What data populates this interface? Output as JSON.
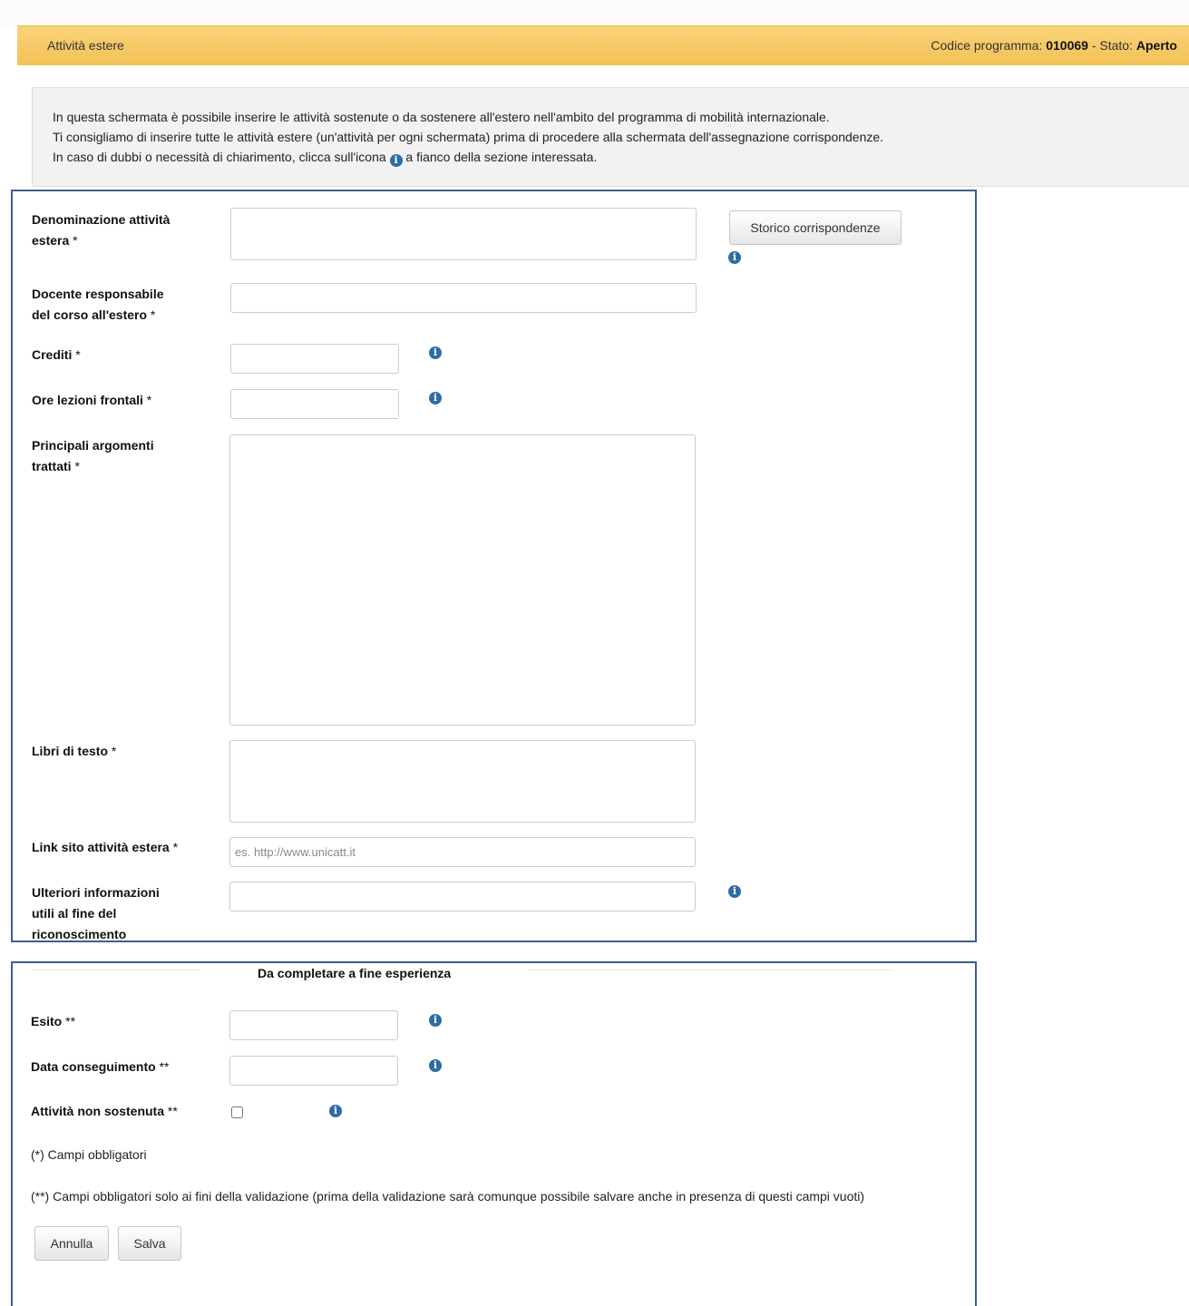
{
  "header": {
    "title": "Attività estere",
    "program_label": "Codice programma: ",
    "program_code": "010069",
    "status_sep": " - Stato: ",
    "status_value": "Aperto"
  },
  "info": {
    "line1": "In questa schermata è possibile inserire le attività sostenute o da sostenere all'estero nell'ambito del programma di mobilità internazionale.",
    "line2": "Ti consigliamo di inserire tutte le attività estere (un'attività per ogni schermata) prima di procedere alla schermata dell'assegnazione corrispondenze.",
    "line3_before": "In caso di dubbi o necessità di chiarimento, clicca sull'icona ",
    "line3_after": " a fianco della sezione interessata."
  },
  "icons": {
    "info": "info-circle-icon",
    "info_color": "#2e6da4"
  },
  "form": {
    "denominazione": {
      "label_l1": "Denominazione attività",
      "label_l2": "estera",
      "req": " *",
      "value": ""
    },
    "storico_button": "Storico corrispondenze",
    "docente": {
      "label_l1": "Docente responsabile",
      "label_l2": "del corso all'estero",
      "req": "  *",
      "value": ""
    },
    "crediti": {
      "label": "Crediti",
      "req": "  *",
      "value": ""
    },
    "ore": {
      "label": "Ore lezioni frontali",
      "req": "  *",
      "value": ""
    },
    "argomenti": {
      "label_l1": "Principali argomenti",
      "label_l2": "trattati",
      "req": "  *",
      "value": ""
    },
    "libri": {
      "label": "Libri di testo",
      "req": "  *",
      "value": ""
    },
    "link": {
      "label": "Link sito attività estera",
      "req": "  *",
      "value": "",
      "placeholder": "es. http://www.unicatt.it"
    },
    "ulteriori": {
      "label_l1": "Ulteriori informazioni",
      "label_l2": "utili al fine del",
      "label_l3": "riconoscimento",
      "value": ""
    }
  },
  "completion": {
    "title": "Da completare a fine esperienza",
    "esito": {
      "label": "Esito",
      "req": " **",
      "value": ""
    },
    "data": {
      "label": "Data conseguimento",
      "req": " **",
      "value": ""
    },
    "non_sostenuta": {
      "label": "Attività non sostenuta",
      "req": " **",
      "checked": false
    },
    "note1": "(*) Campi obbligatori",
    "note2": "(**) Campi obbligatori solo ai fini della validazione (prima della validazione sarà comunque possibile salvare anche in presenza di questi campi vuoti)",
    "annulla": "Annulla",
    "salva": "Salva"
  },
  "colors": {
    "header_gradient_top": "#f9d27a",
    "header_gradient_bottom": "#f3c255",
    "panel_border": "#3b5f8f",
    "info_background": "#f2f2f2"
  }
}
